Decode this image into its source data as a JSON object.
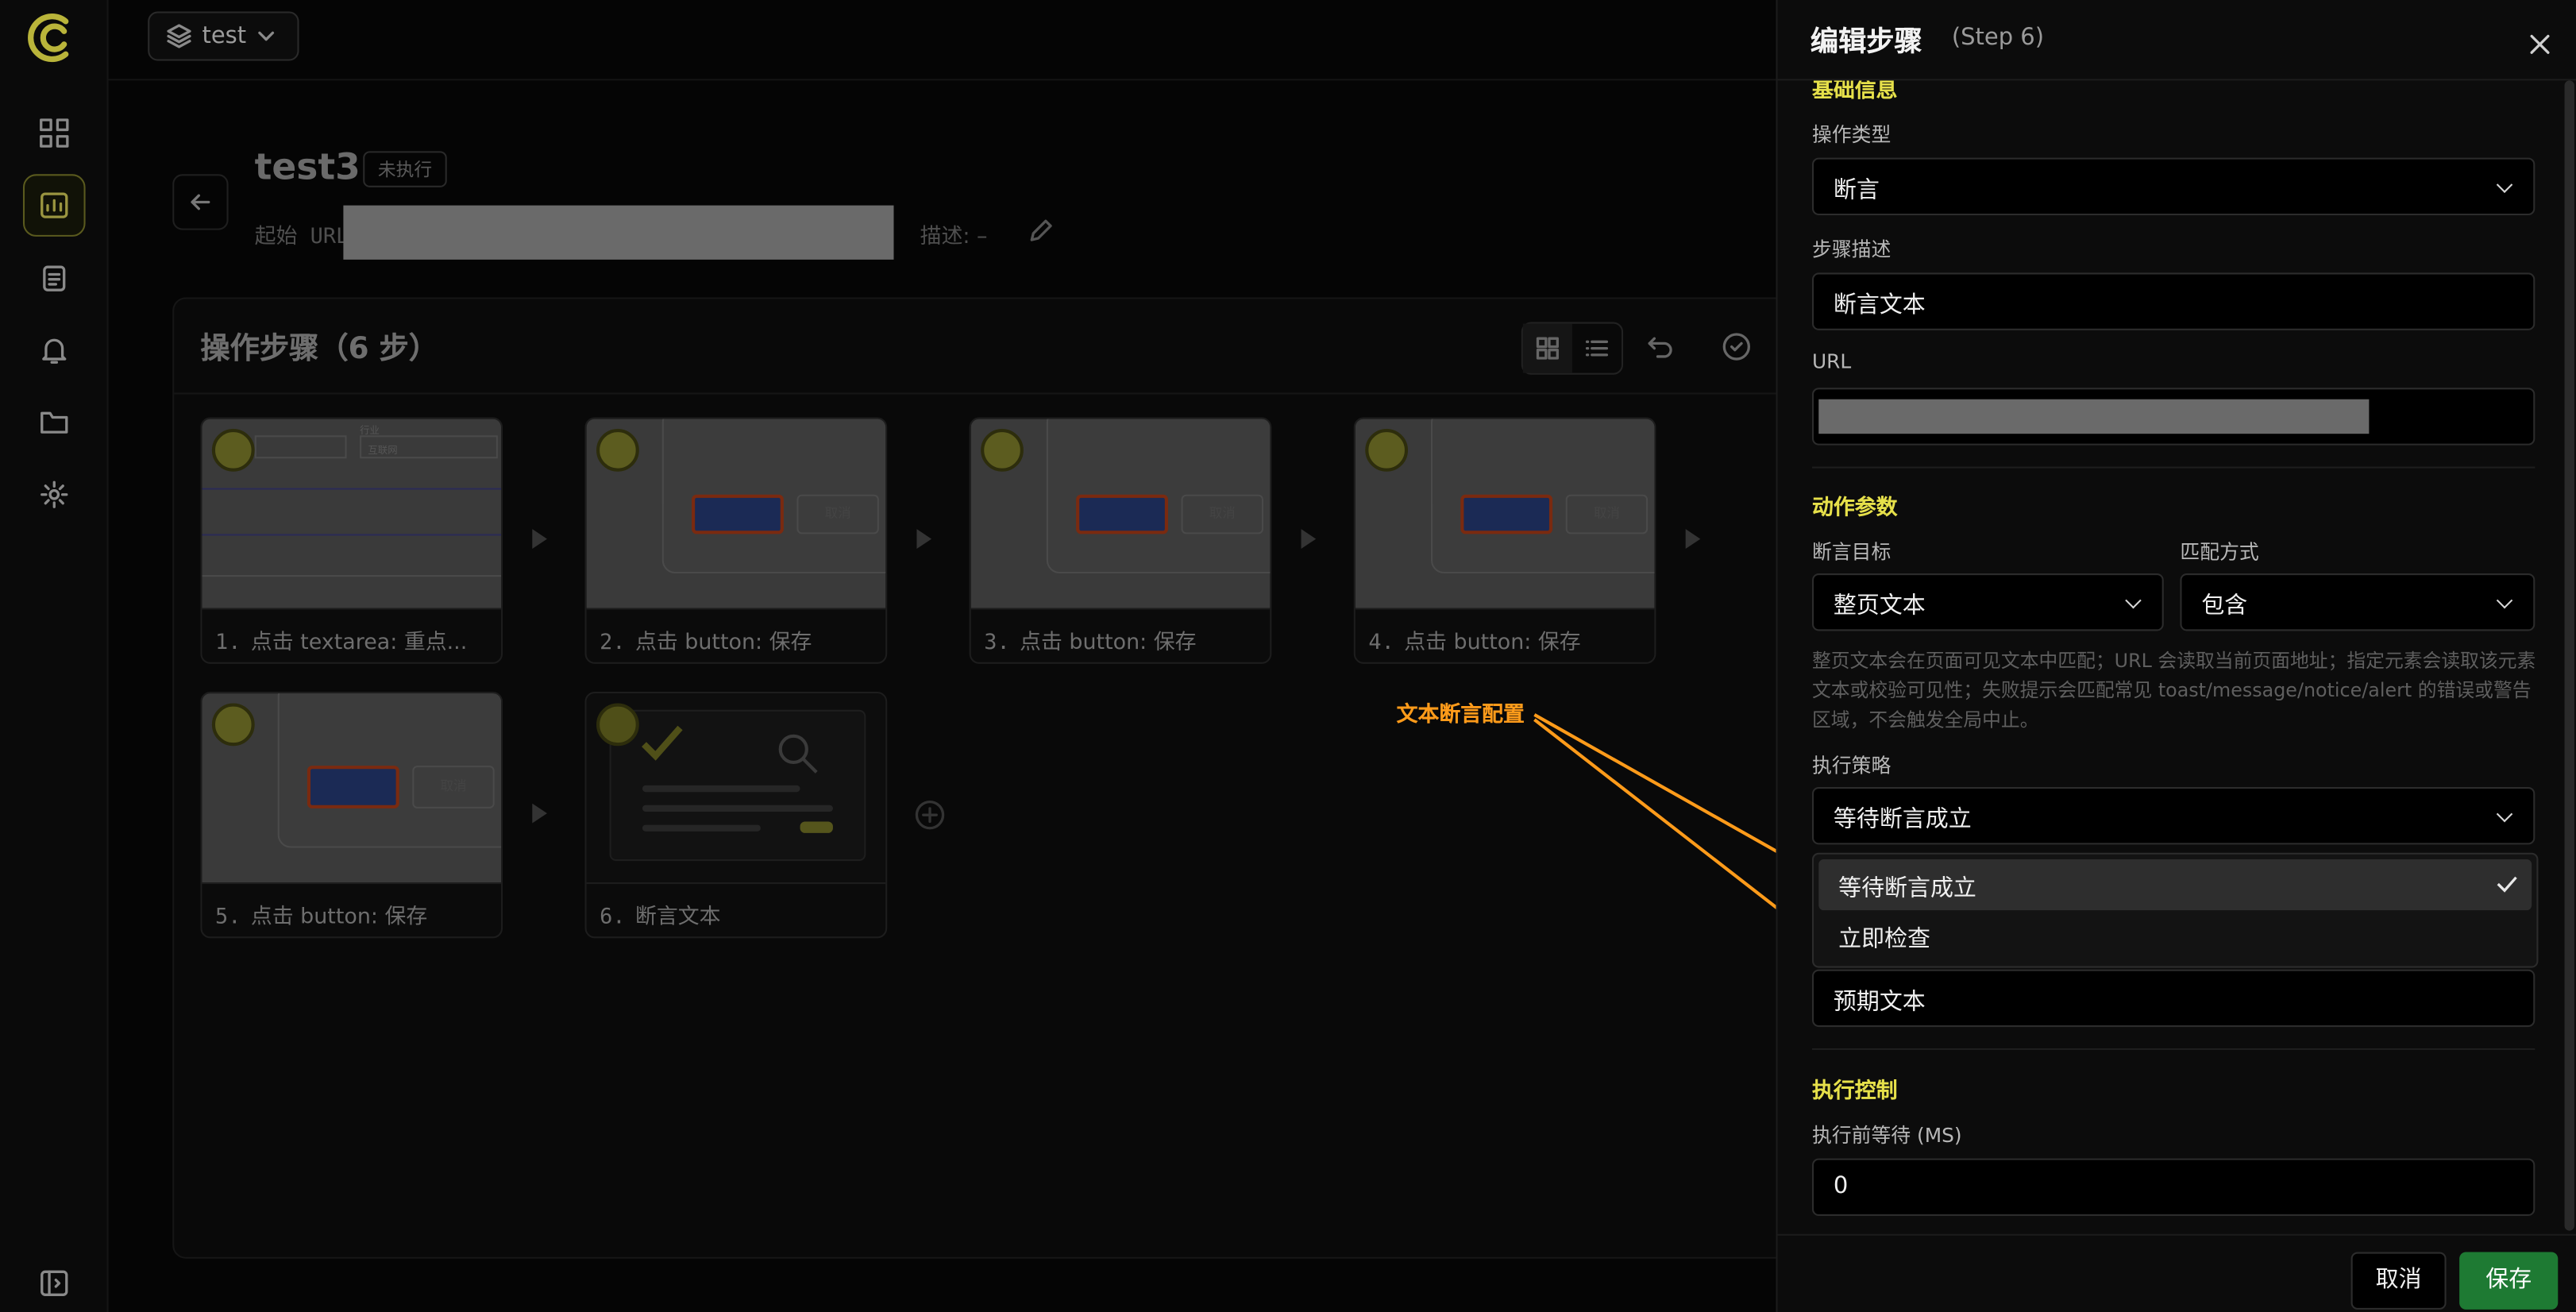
{
  "topbar": {
    "project_label": "test"
  },
  "page": {
    "title": "test3",
    "status_badge": "未执行",
    "start_url_label": "起始 URL",
    "desc_label": "描述: –"
  },
  "steps_panel": {
    "title": "操作步骤（6 步）"
  },
  "steps": [
    {
      "num": "1.",
      "label": "点击 textarea: 重点..."
    },
    {
      "num": "2.",
      "label": "点击 button: 保存"
    },
    {
      "num": "3.",
      "label": "点击 button: 保存"
    },
    {
      "num": "4.",
      "label": "点击 button: 保存"
    },
    {
      "num": "5.",
      "label": "点击 button: 保存"
    },
    {
      "num": "6.",
      "label": "断言文本"
    }
  ],
  "thumb_text": {
    "field1": "行业",
    "field2": "互联网",
    "cancel": "取消"
  },
  "drawer": {
    "title": "编辑步骤",
    "subtitle": "(Step 6)",
    "section_basic": "基础信息",
    "op_type_label": "操作类型",
    "op_type_value": "断言",
    "step_desc_label": "步骤描述",
    "step_desc_value": "断言文本",
    "url_label": "URL",
    "section_action": "动作参数",
    "assert_target_label": "断言目标",
    "assert_target_value": "整页文本",
    "match_label": "匹配方式",
    "match_value": "包含",
    "help_text": "整页文本会在页面可见文本中匹配；URL 会读取当前页面地址；指定元素会读取该元素文本或校验可见性；失败提示会匹配常见 toast/message/notice/alert 的错误或警告区域，不会触发全局中止。",
    "strategy_label": "执行策略",
    "strategy_value": "等待断言成立",
    "strategy_options": [
      "等待断言成立",
      "立即检查"
    ],
    "expected_value": "预期文本",
    "section_exec": "执行控制",
    "wait_label": "执行前等待 (MS)",
    "wait_value": "0",
    "cancel_label": "取消",
    "save_label": "保存"
  },
  "annotation": {
    "text": "文本断言配置",
    "color": "#ff9b1a"
  },
  "colors": {
    "accent": "#e6e04a",
    "save": "#1e7a33"
  }
}
